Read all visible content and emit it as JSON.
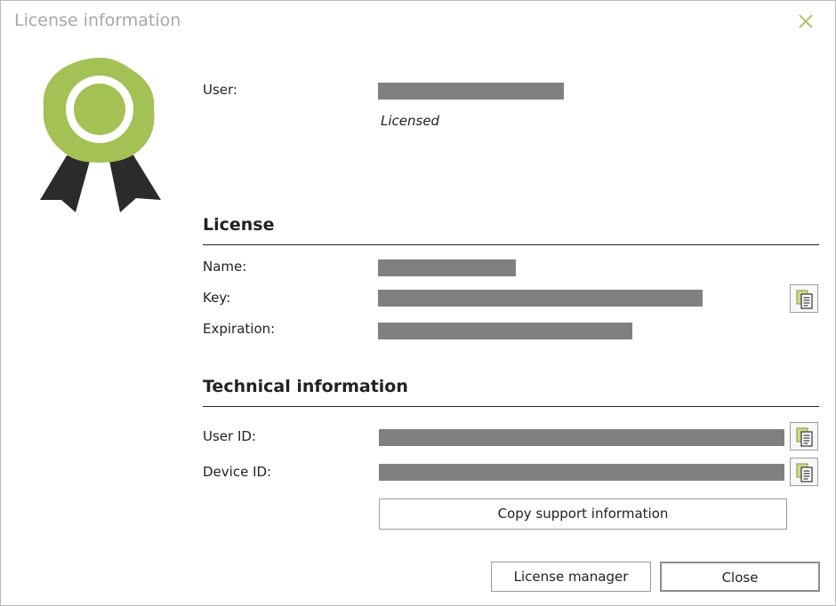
{
  "window": {
    "title": "License information"
  },
  "user": {
    "label": "User:",
    "status": "Licensed"
  },
  "license": {
    "heading": "License",
    "name_label": "Name:",
    "key_label": "Key:",
    "expiration_label": "Expiration:"
  },
  "technical": {
    "heading": "Technical information",
    "user_id_label": "User ID:",
    "device_id_label": "Device ID:"
  },
  "buttons": {
    "copy_support": "Copy support information",
    "license_manager": "License manager",
    "close": "Close"
  },
  "colors": {
    "accent": "#a3c155",
    "redaction": "#808080",
    "ribbon": "#2b2b2b"
  },
  "icons": {
    "close": "close-icon",
    "badge": "award-badge-icon",
    "copy": "copy-icon"
  }
}
